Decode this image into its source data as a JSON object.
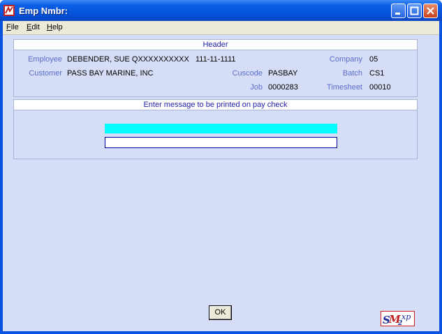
{
  "window": {
    "title": "Emp Nmbr:"
  },
  "menu": [
    {
      "hot": "F",
      "rest": "ile"
    },
    {
      "hot": "E",
      "rest": "dit"
    },
    {
      "hot": "H",
      "rest": "elp"
    }
  ],
  "header": {
    "title": "Header",
    "employee_label": "Employee",
    "employee_name": "DEBENDER, SUE QXXXXXXXXXX",
    "employee_ssn": "111-11-1111",
    "company_label": "Company",
    "company": "05",
    "customer_label": "Customer",
    "customer": "PASS BAY MARINE, INC",
    "cuscode_label": "Cuscode",
    "cuscode": "PASBAY",
    "batch_label": "Batch",
    "batch": "CS1",
    "job_label": "Job",
    "job": "0000283",
    "timesheet_label": "Timesheet",
    "timesheet": "00010"
  },
  "message": {
    "title": "Enter message to be printed on pay check",
    "line1": "",
    "line2": ""
  },
  "ok_label": "OK",
  "logo": {
    "text": "SM2",
    "sup": "xp"
  },
  "colors": {
    "title_bar": "#0550d8",
    "client_bg": "#d6def7",
    "label": "#5c6cc8",
    "highlight": "#00ffff"
  }
}
